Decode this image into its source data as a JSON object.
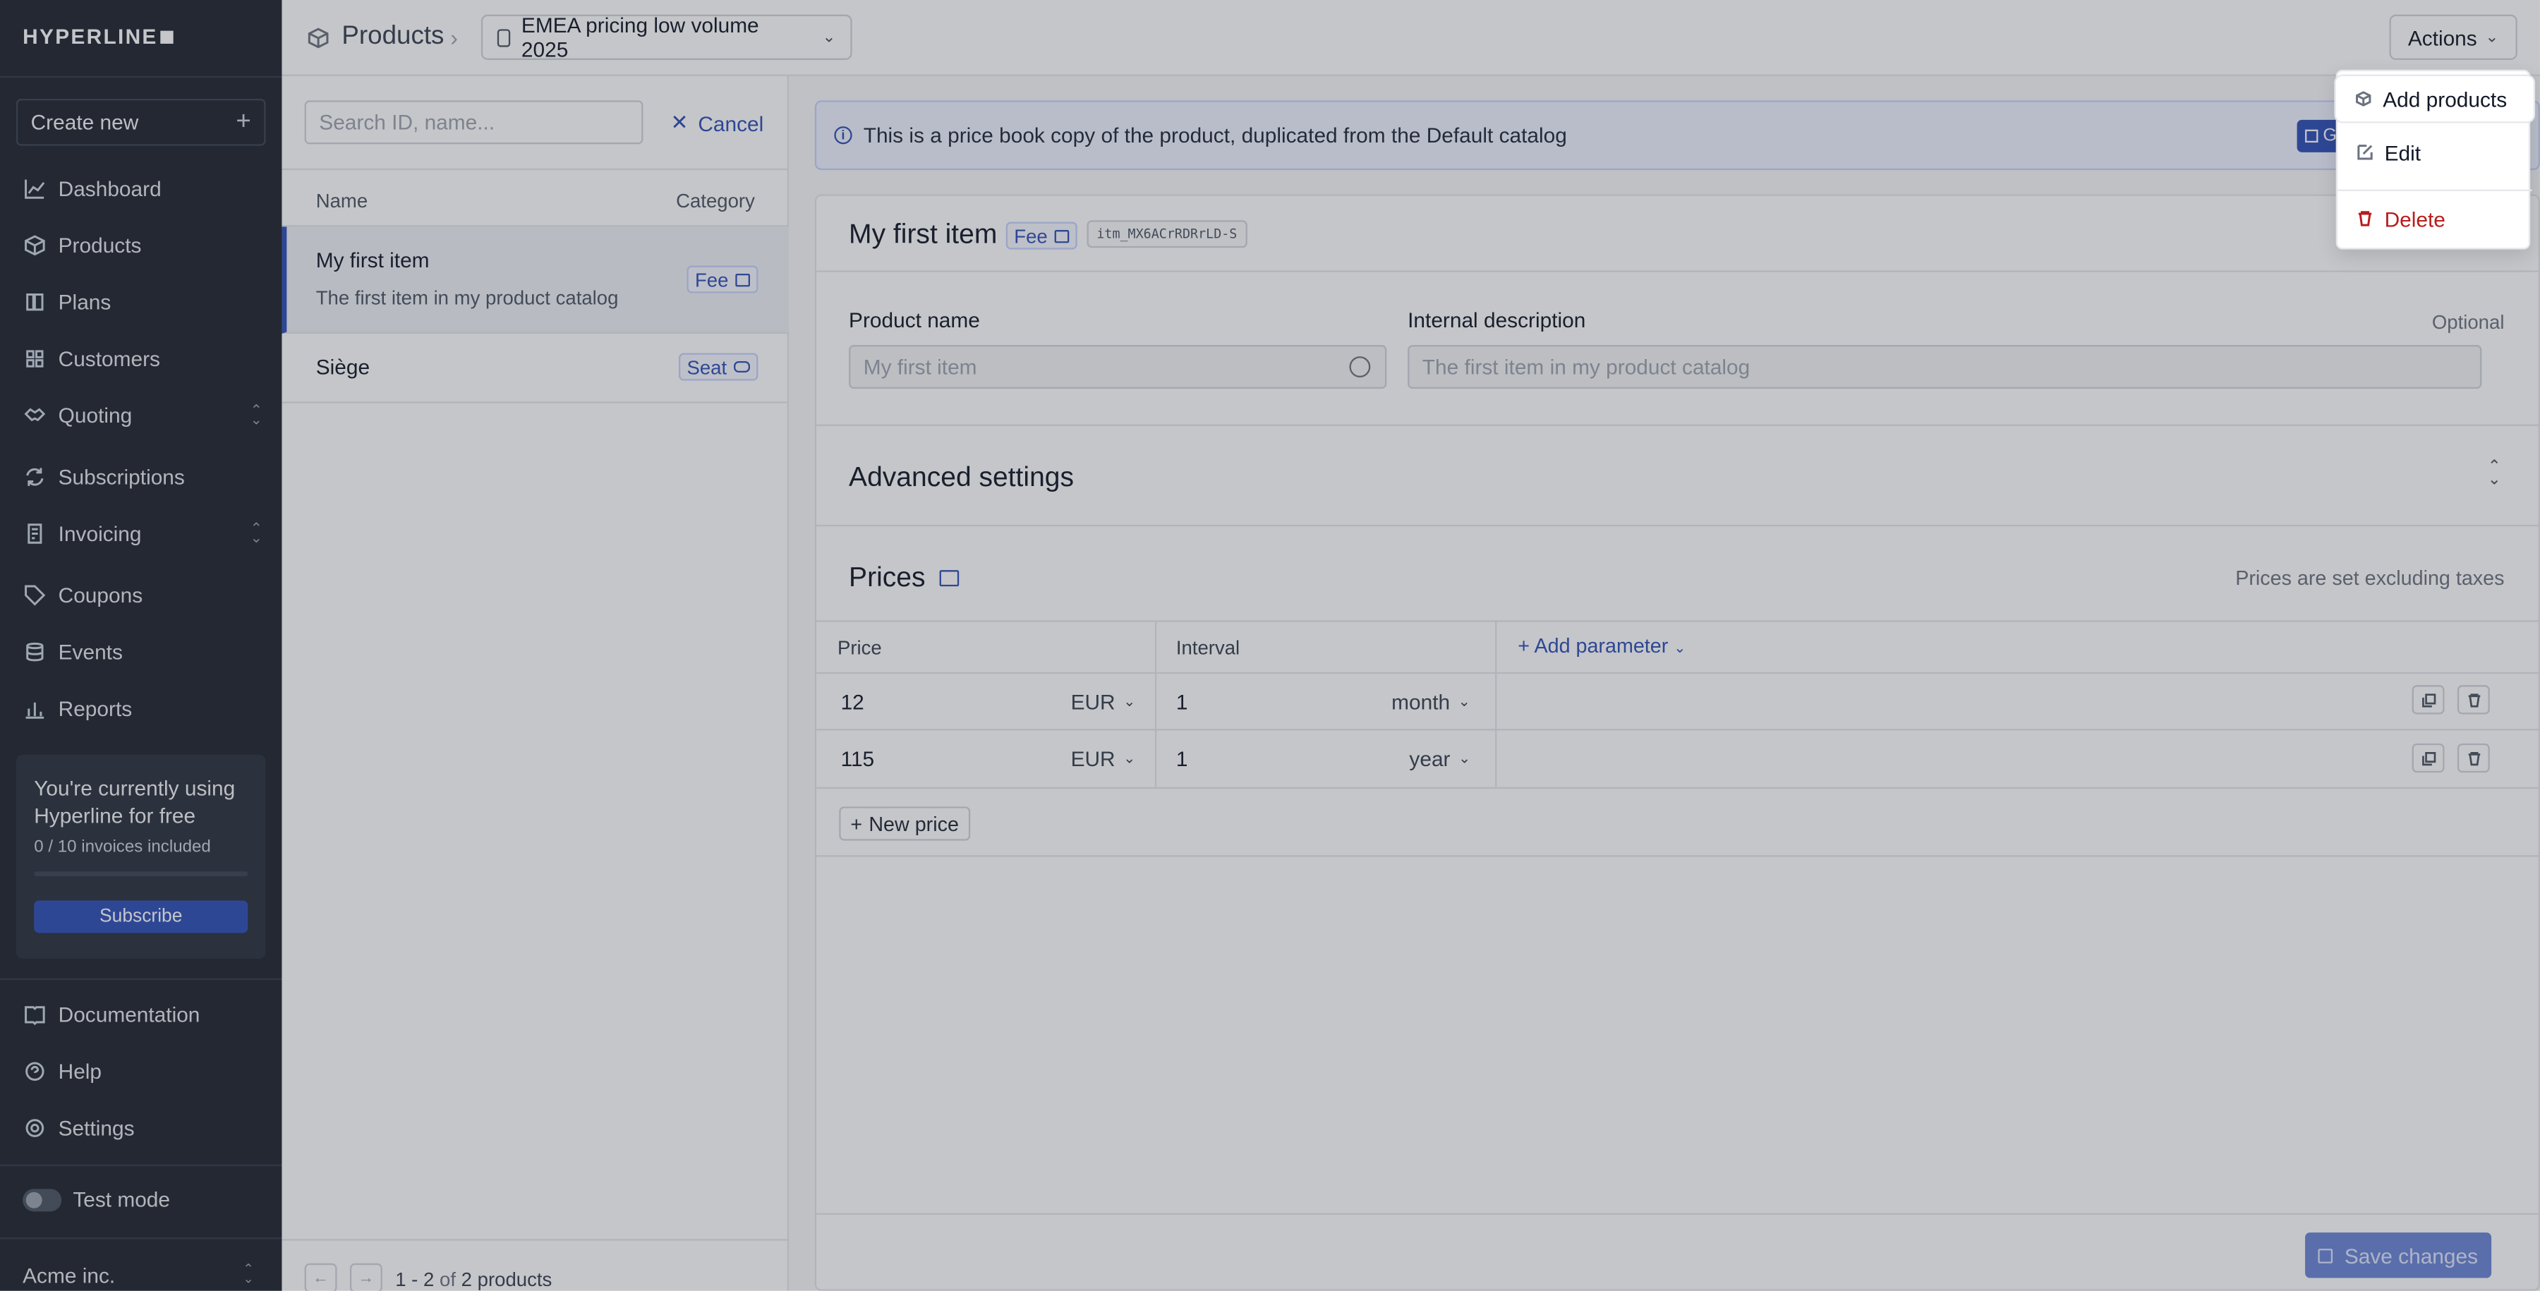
{
  "sidebar": {
    "logo": "HYPERLINE",
    "create_new": "Create new",
    "items": [
      {
        "label": "Dashboard",
        "icon": "chart-line-icon"
      },
      {
        "label": "Products",
        "icon": "box-icon"
      },
      {
        "label": "Plans",
        "icon": "book-icon"
      },
      {
        "label": "Customers",
        "icon": "users-icon"
      },
      {
        "label": "Quoting",
        "icon": "handshake-icon"
      },
      {
        "label": "Subscriptions",
        "icon": "refresh-icon"
      },
      {
        "label": "Invoicing",
        "icon": "invoice-icon"
      },
      {
        "label": "Coupons",
        "icon": "tag-icon"
      },
      {
        "label": "Events",
        "icon": "database-icon"
      },
      {
        "label": "Reports",
        "icon": "bar-chart-icon"
      }
    ],
    "promo": {
      "text": "You're currently using Hyperline for free",
      "usage": "0 / 10 invoices included",
      "usage_fraction": 0,
      "button": "Subscribe"
    },
    "bottom_items": [
      {
        "label": "Documentation",
        "icon": "book-open-icon"
      },
      {
        "label": "Help",
        "icon": "help-chat-icon"
      },
      {
        "label": "Settings",
        "icon": "gear-icon"
      }
    ],
    "test_mode": "Test mode",
    "test_mode_on": false,
    "account": "Acme inc."
  },
  "topbar": {
    "breadcrumb": "Products",
    "catalog": "EMEA pricing low volume 2025",
    "actions": "Actions"
  },
  "list": {
    "search_placeholder": "Search ID, name...",
    "cancel": "Cancel",
    "col_name": "Name",
    "col_category": "Category",
    "rows": [
      {
        "name": "My first item",
        "description": "The first item in my product catalog",
        "category": "Fee"
      },
      {
        "name": "Siège",
        "description": "",
        "category": "Seat"
      }
    ],
    "pagination": {
      "range": "1 - 2",
      "of": "of",
      "total": "2 products"
    }
  },
  "main": {
    "info_banner": "This is a price book copy of the product, duplicated from the Default catalog",
    "info_button": "G",
    "product": {
      "title": "My first item",
      "category": "Fee",
      "id": "itm_MX6ACrRDRrLD-S"
    },
    "fields": {
      "name_label": "Product name",
      "name_placeholder": "My first item",
      "desc_label": "Internal description",
      "desc_optional": "Optional",
      "desc_placeholder": "The first item in my product catalog"
    },
    "advanced": "Advanced settings",
    "prices": {
      "title": "Prices",
      "note": "Prices are set excluding taxes",
      "col_price": "Price",
      "col_interval": "Interval",
      "add_parameter": "Add parameter",
      "rows": [
        {
          "amount": "12",
          "currency": "EUR",
          "count": "1",
          "period": "month"
        },
        {
          "amount": "115",
          "currency": "EUR",
          "count": "1",
          "period": "year"
        }
      ],
      "new_price": "New price"
    },
    "save": "Save changes"
  },
  "actions_menu": {
    "items": [
      {
        "label": "Add products",
        "icon": "box-icon"
      },
      {
        "label": "Edit",
        "icon": "edit-icon"
      },
      {
        "label": "Delete",
        "icon": "trash-icon"
      }
    ]
  },
  "colors": {
    "sidebar_bg": "#1f2530",
    "accent": "#2f4fb8",
    "danger": "#b91c1c"
  }
}
